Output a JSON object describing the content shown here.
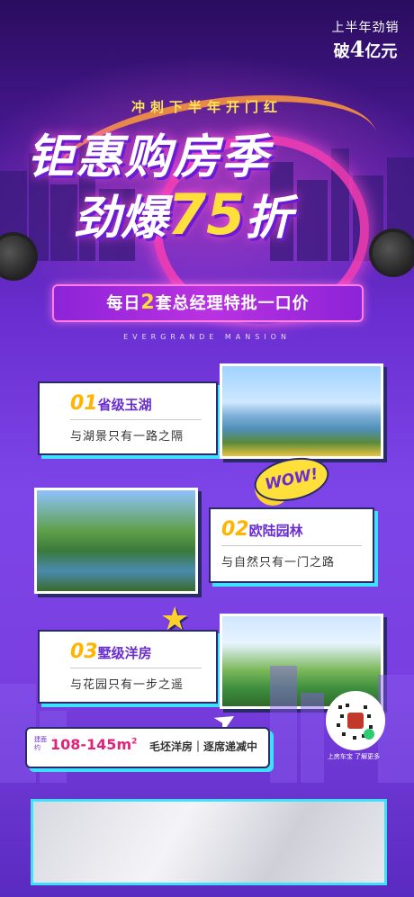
{
  "header": {
    "tagline": "冲刺下半年开门红",
    "title_line1": "钜惠购房季",
    "title_line2_prefix": "劲爆",
    "title_line2_number": "75",
    "title_line2_suffix": "折",
    "badge_line1": "上半年劲销",
    "badge_line2_prefix": "破",
    "badge_line2_number": "4",
    "badge_line2_suffix": "亿元",
    "banner_prefix": "每日",
    "banner_highlight": "2",
    "banner_suffix": "套总经理特批一口价",
    "english_sub": "EVERGRANDE MANSION"
  },
  "features": [
    {
      "num": "01",
      "title": "省级玉湖",
      "text": "与湖景只有一路之隔"
    },
    {
      "num": "02",
      "title": "欧陆园林",
      "text": "与自然只有一门之路"
    },
    {
      "num": "03",
      "title": "墅级洋房",
      "text": "与花园只有一步之遥"
    }
  ],
  "decor": {
    "wow": "WOW!"
  },
  "price": {
    "tiny_label": "建面约",
    "area": "108-145m",
    "area_sup": "2",
    "desc": "毛坯洋房｜逐席递减中"
  },
  "qr_caption": "上房车宝 了解更多",
  "colors": {
    "accent_yellow": "#ffe03a",
    "accent_cyan": "#3ee0ff",
    "accent_purple": "#6a2ed0",
    "accent_pink": "#ff4fd8"
  }
}
